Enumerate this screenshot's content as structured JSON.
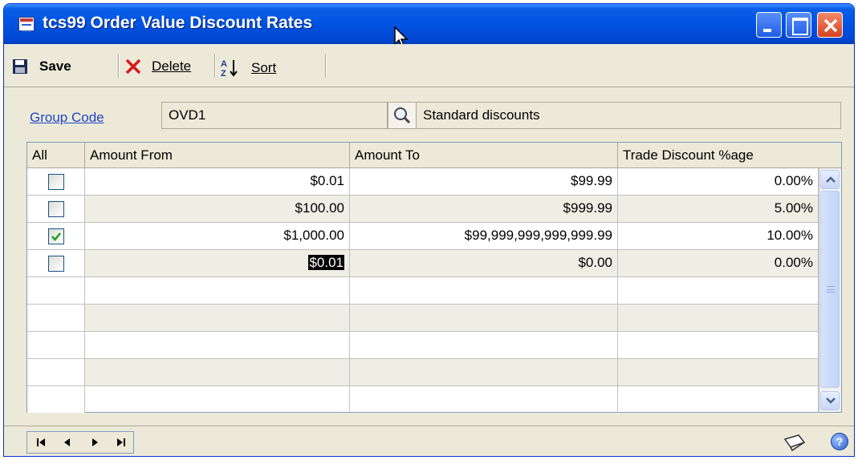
{
  "window": {
    "title": "tcs99 Order Value Discount Rates"
  },
  "toolbar": {
    "save_label": "Save",
    "delete_label": "Delete",
    "sort_label": "Sort"
  },
  "form": {
    "group_code_label": "Group Code",
    "group_code_value": "OVD1",
    "description_value": "Standard discounts"
  },
  "grid": {
    "columns": [
      "All",
      "Amount From",
      "Amount To",
      "Trade Discount %age"
    ],
    "rows": [
      {
        "checked": false,
        "amount_from": "$0.01",
        "amount_to": "$99.99",
        "discount": "0.00%"
      },
      {
        "checked": false,
        "amount_from": "$100.00",
        "amount_to": "$999.99",
        "discount": "5.00%"
      },
      {
        "checked": true,
        "amount_from": "$1,000.00",
        "amount_to": "$99,999,999,999,999.99",
        "discount": "10.00%"
      },
      {
        "checked": false,
        "amount_from": "$0.01",
        "amount_to": "$0.00",
        "discount": "0.00%"
      }
    ],
    "empty_row_count": 5
  },
  "icons": {
    "save": "floppy-disk-icon",
    "delete": "red-x-icon",
    "sort": "sort-az-icon",
    "lookup": "magnifier-icon",
    "note": "note-icon",
    "help": "help-icon"
  }
}
